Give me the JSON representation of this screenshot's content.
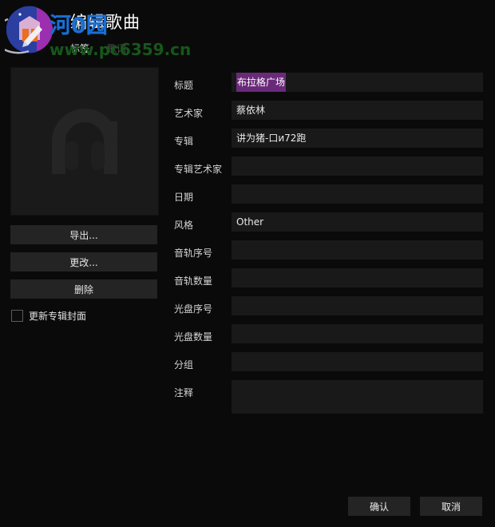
{
  "dialog": {
    "title": "编辑歌曲",
    "tabs": [
      {
        "label": "标签",
        "active": true
      },
      {
        "label": "歌词",
        "active": false
      }
    ]
  },
  "watermark": {
    "line1": "河0园",
    "line2": "www.pc6359.cn",
    "logo_icon": "circle-logo-icon",
    "blue_hex": "#1a6fd4",
    "green_hex": "#17561c"
  },
  "artwork": {
    "placeholder_icon": "headphones-icon",
    "background_hex": "#1a1a1a"
  },
  "side_buttons": [
    {
      "label": "导出...",
      "name": "export-button"
    },
    {
      "label": "更改...",
      "name": "change-button"
    },
    {
      "label": "删除",
      "name": "delete-button"
    }
  ],
  "checkbox": {
    "label": "更新专辑封面",
    "checked": false
  },
  "fields": [
    {
      "label": "标题",
      "value": "布拉格广场",
      "placeholder": "",
      "selected": true,
      "tall": false
    },
    {
      "label": "艺术家",
      "value": "蔡依林",
      "placeholder": "",
      "selected": false,
      "tall": false
    },
    {
      "label": "专辑",
      "value": "讲为猪-口и72跑",
      "placeholder": "",
      "selected": false,
      "tall": false
    },
    {
      "label": "专辑艺术家",
      "value": "",
      "placeholder": "",
      "selected": false,
      "tall": false
    },
    {
      "label": "日期",
      "value": "",
      "placeholder": "",
      "selected": false,
      "tall": false
    },
    {
      "label": "风格",
      "value": "Other",
      "placeholder": "",
      "selected": false,
      "tall": false
    },
    {
      "label": "音轨序号",
      "value": "",
      "placeholder": "",
      "selected": false,
      "tall": false
    },
    {
      "label": "音轨数量",
      "value": "",
      "placeholder": "",
      "selected": false,
      "tall": false
    },
    {
      "label": "光盘序号",
      "value": "",
      "placeholder": "",
      "selected": false,
      "tall": false
    },
    {
      "label": "光盘数量",
      "value": "",
      "placeholder": "",
      "selected": false,
      "tall": false
    },
    {
      "label": "分组",
      "value": "",
      "placeholder": "",
      "selected": false,
      "tall": false
    },
    {
      "label": "注释",
      "value": "",
      "placeholder": "",
      "selected": false,
      "tall": true
    }
  ],
  "footer": {
    "ok_label": "确认",
    "cancel_label": "取消"
  },
  "theme": {
    "background_hex": "#0a0a0a",
    "field_hex": "#191919",
    "button_hex": "#242424",
    "selection_hex": "#6a2a7a",
    "text_hex": "#d8d8d8"
  }
}
